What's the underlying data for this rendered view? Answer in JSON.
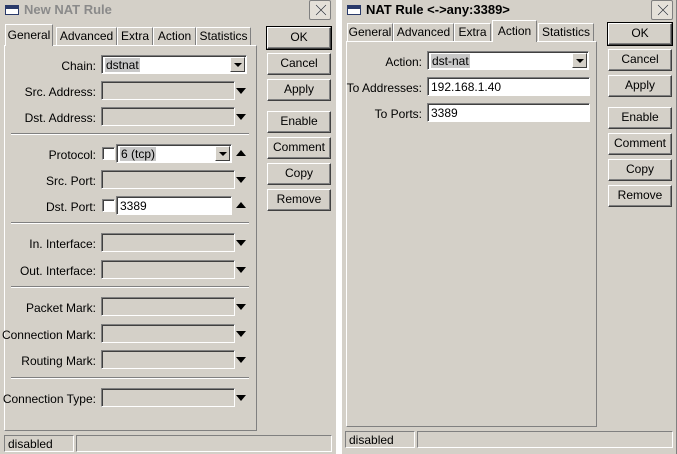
{
  "window1": {
    "title": "New NAT Rule",
    "tabs": [
      {
        "label": "General"
      },
      {
        "label": "Advanced"
      },
      {
        "label": "Extra"
      },
      {
        "label": "Action"
      },
      {
        "label": "Statistics"
      }
    ],
    "active_tab": "General",
    "fields": {
      "chain": {
        "label": "Chain:",
        "value": "dstnat"
      },
      "src_address": {
        "label": "Src. Address:",
        "value": ""
      },
      "dst_address": {
        "label": "Dst. Address:",
        "value": ""
      },
      "protocol": {
        "label": "Protocol:",
        "value": "6 (tcp)"
      },
      "src_port": {
        "label": "Src. Port:",
        "value": ""
      },
      "dst_port": {
        "label": "Dst. Port:",
        "value": "3389"
      },
      "in_interface": {
        "label": "In. Interface:",
        "value": ""
      },
      "out_interface": {
        "label": "Out. Interface:",
        "value": ""
      },
      "packet_mark": {
        "label": "Packet Mark:",
        "value": ""
      },
      "connection_mark": {
        "label": "Connection Mark:",
        "value": ""
      },
      "routing_mark": {
        "label": "Routing Mark:",
        "value": ""
      },
      "connection_type": {
        "label": "Connection Type:",
        "value": ""
      }
    },
    "buttons": {
      "ok": "OK",
      "cancel": "Cancel",
      "apply": "Apply",
      "enable": "Enable",
      "comment": "Comment",
      "copy": "Copy",
      "remove": "Remove"
    },
    "status": "disabled"
  },
  "window2": {
    "title": "NAT Rule <->any:3389>",
    "tabs": [
      {
        "label": "General"
      },
      {
        "label": "Advanced"
      },
      {
        "label": "Extra"
      },
      {
        "label": "Action"
      },
      {
        "label": "Statistics"
      }
    ],
    "active_tab": "Action",
    "fields": {
      "action": {
        "label": "Action:",
        "value": "dst-nat"
      },
      "to_addresses": {
        "label": "To Addresses:",
        "value": "192.168.1.40"
      },
      "to_ports": {
        "label": "To Ports:",
        "value": "3389"
      }
    },
    "buttons": {
      "ok": "OK",
      "cancel": "Cancel",
      "apply": "Apply",
      "enable": "Enable",
      "comment": "Comment",
      "copy": "Copy",
      "remove": "Remove"
    },
    "status": "disabled"
  }
}
